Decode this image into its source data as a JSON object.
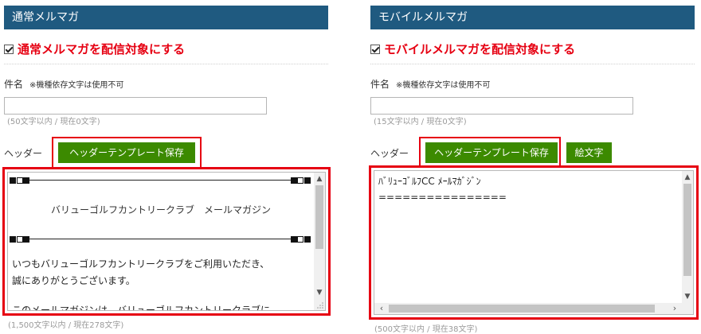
{
  "left": {
    "section_title": "通常メルマガ",
    "checkbox_label": "通常メルマガを配信対象にする",
    "subject_label": "件名",
    "subject_note": "※機種依存文字は使用不可",
    "subject_value": "",
    "subject_counter": "(50文字以内 / 現在0文字)",
    "header_label": "ヘッダー",
    "header_template_button": "ヘッダーテンプレート保存",
    "header_text_title": "バリューゴルフカントリークラブ　メールマガジン",
    "header_text_lines": [
      "いつもバリューゴルフカントリークラブをご利用いただき、",
      "誠にありがとうございます。",
      "",
      "このメールマガジンは、バリューゴルフカントリークラブに"
    ],
    "header_counter": "(1,500文字以内 / 現在278文字)"
  },
  "right": {
    "section_title": "モバイルメルマガ",
    "checkbox_label": "モバイルメルマガを配信対象にする",
    "subject_label": "件名",
    "subject_note": "※機種依存文字は使用不可",
    "subject_value": "",
    "subject_counter": "(15文字以内 / 現在0文字)",
    "header_label": "ヘッダー",
    "header_template_button": "ヘッダーテンプレート保存",
    "emoji_button": "絵文字",
    "header_text_line1": "ﾊﾞﾘｭｰｺﾞﾙﾌCC ﾒｰﾙﾏｶﾞｼﾞﾝ",
    "header_text_line2": "================",
    "header_counter": "(500文字以内 / 現在38文字)"
  },
  "colors": {
    "section_header_bg": "#1f5a80",
    "accent_red": "#e60012",
    "button_green": "#3c8a00"
  }
}
